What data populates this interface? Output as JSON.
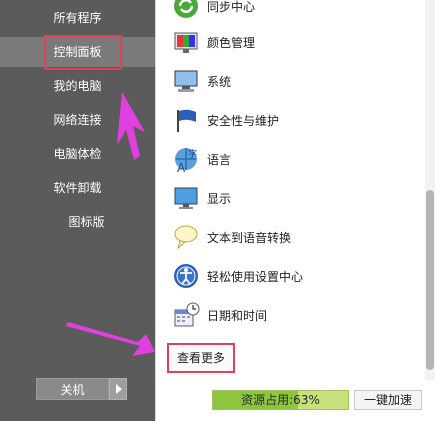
{
  "sidebar": {
    "items": [
      {
        "label": "所有程序"
      },
      {
        "label": "控制面板"
      },
      {
        "label": "我的电脑"
      },
      {
        "label": "网络连接"
      },
      {
        "label": "电脑体检"
      },
      {
        "label": "软件卸载"
      },
      {
        "label": "图标版"
      }
    ],
    "shutdown_label": "关机"
  },
  "main": {
    "items": [
      {
        "label": "同步中心",
        "icon": "sync-icon"
      },
      {
        "label": "颜色管理",
        "icon": "color-management-icon"
      },
      {
        "label": "系统",
        "icon": "system-icon"
      },
      {
        "label": "安全性与维护",
        "icon": "flag-icon"
      },
      {
        "label": "语言",
        "icon": "language-icon"
      },
      {
        "label": "显示",
        "icon": "display-icon"
      },
      {
        "label": "文本到语音转换",
        "icon": "speech-icon"
      },
      {
        "label": "轻松使用设置中心",
        "icon": "accessibility-icon"
      },
      {
        "label": "日期和时间",
        "icon": "calendar-clock-icon"
      }
    ],
    "view_more_label": "查看更多"
  },
  "footer": {
    "usage_label": "资源占用:63%",
    "usage_percent": 63,
    "speedup_label": "一键加速"
  },
  "colors": {
    "sidebar_bg": "#5b5b5b",
    "highlight": "#e0405a",
    "annotation_arrow": "#e040e0",
    "usage_green": "#8cc63f"
  }
}
